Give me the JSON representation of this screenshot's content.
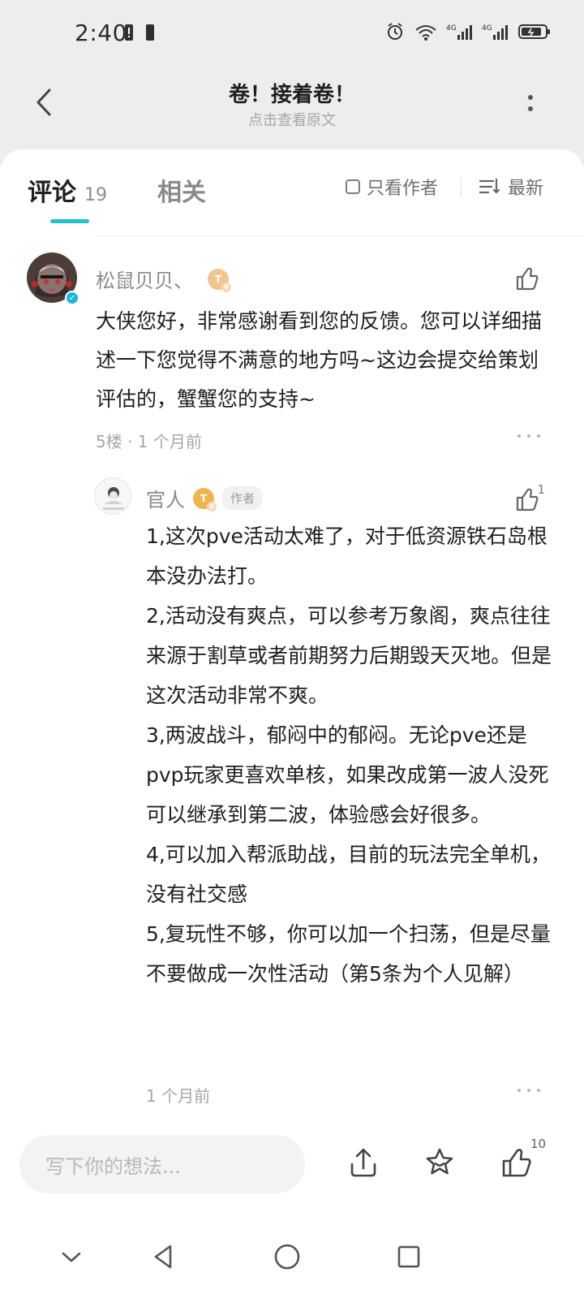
{
  "status_bar": {
    "time": "2:40",
    "left_icons": [
      "alert-icon",
      "battery-saver-icon"
    ],
    "right_icons": [
      "alarm-icon",
      "wifi-icon",
      "signal-4g-icon",
      "signal-4g-icon",
      "battery-icon"
    ]
  },
  "header": {
    "title": "卷！接着卷！",
    "subtitle": "点击查看原文"
  },
  "tabs": {
    "comments_label": "评论",
    "comments_count": "19",
    "related_label": "相关",
    "filter_author_label": "只看作者",
    "sort_label": "最新"
  },
  "comments": [
    {
      "username": "松鼠贝贝、",
      "level": "T",
      "level_num": "6",
      "text": "大侠您好，非常感谢看到您的反馈。您可以详细描述一下您觉得不满意的地方吗~这边会提交给策划评估的，蟹蟹您的支持~",
      "floor_time": "5楼 · 1 个月前"
    }
  ],
  "reply": {
    "username": "官人",
    "level": "T",
    "level_num": "8",
    "tag": "作者",
    "like_count": "1",
    "paragraphs": [
      "1,这次pve活动太难了，对于低资源铁石岛根本没办法打。",
      "2,活动没有爽点，可以参考万象阁，爽点往往来源于割草或者前期努力后期毁天灭地。但是这次活动非常不爽。",
      "3,两波战斗，郁闷中的郁闷。无论pve还是pvp玩家更喜欢单核，如果改成第一波人没死可以继承到第二波，体验感会好很多。",
      "4,可以加入帮派助战，目前的玩法完全单机，没有社交感",
      "5,复玩性不够，你可以加一个扫荡，但是尽量不要做成一次性活动（第5条为个人见解）"
    ],
    "time": "1 个月前"
  },
  "bottom_bar": {
    "input_placeholder": "写下你的想法...",
    "like_count": "10",
    "actions": [
      "share-icon",
      "favorite-icon",
      "like-icon"
    ]
  },
  "nav_bar": {
    "buttons": [
      "down-icon",
      "back-icon",
      "home-icon",
      "recent-icon"
    ]
  },
  "colors": {
    "accent": "#25c2c6",
    "badge_gold": "#f3c58e"
  }
}
